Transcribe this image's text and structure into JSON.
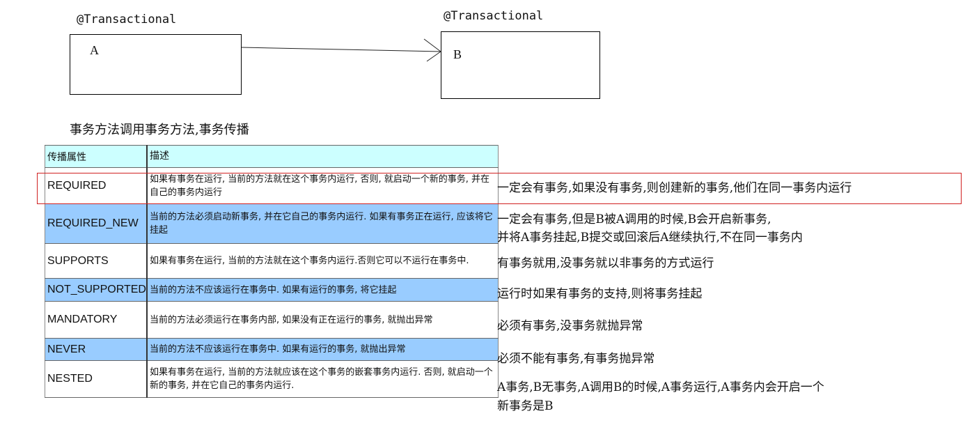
{
  "diagram": {
    "annotation_a": "@Transactional",
    "annotation_b": "@Transactional",
    "box_a_label": "A",
    "box_b_label": "B"
  },
  "heading": "事务方法调用事务方法,事务传播",
  "table": {
    "header": {
      "name": "传播属性",
      "desc": "描述"
    },
    "rows": [
      {
        "name": "REQUIRED",
        "desc": "如果有事务在运行, 当前的方法就在这个事务内运行, 否则, 就启动一个新的事务, 并在自己的事务内运行",
        "note": "一定会有事务,如果没有事务,则创建新的事务,他们在同一事务内运行",
        "style": "white"
      },
      {
        "name": "REQUIRED_NEW",
        "desc": "当前的方法必须启动新事务, 并在它自己的事务内运行. 如果有事务正在运行, 应该将它挂起",
        "note_lines": [
          "一定会有事务,但是B被A调用的时候,B会开启新事务,",
          "并将A事务挂起,B提交或回滚后A继续执行,不在同一事务内"
        ],
        "style": "blue"
      },
      {
        "name": "SUPPORTS",
        "desc": "如果有事务在运行, 当前的方法就在这个事务内运行.否则它可以不运行在事务中.",
        "note": "有事务就用,没事务就以非事务的方式运行",
        "style": "white"
      },
      {
        "name": "NOT_SUPPORTED",
        "desc": "当前的方法不应该运行在事务中. 如果有运行的事务, 将它挂起",
        "note": "运行时如果有事务的支持,则将事务挂起",
        "style": "blue"
      },
      {
        "name": "MANDATORY",
        "desc": "当前的方法必须运行在事务内部, 如果没有正在运行的事务, 就抛出异常",
        "note": "必须有事务,没事务就抛异常",
        "style": "white"
      },
      {
        "name": "NEVER",
        "desc": "当前的方法不应该运行在事务中. 如果有运行的事务, 就抛出异常",
        "note": "必须不能有事务,有事务抛异常",
        "style": "blue"
      },
      {
        "name": "NESTED",
        "desc": "如果有事务在运行, 当前的方法就应该在这个事务的嵌套事务内运行. 否则, 就启动一个新的事务, 并在它自己的事务内运行.",
        "note_lines": [
          "A事务,B无事务,A调用B的时候,A事务运行,A事务内会开启一个",
          "新事务是B"
        ],
        "style": "white"
      }
    ]
  },
  "colors": {
    "header_bg": "#ccffff",
    "row_blue": "#99ccff",
    "highlight_border": "#d02020"
  }
}
